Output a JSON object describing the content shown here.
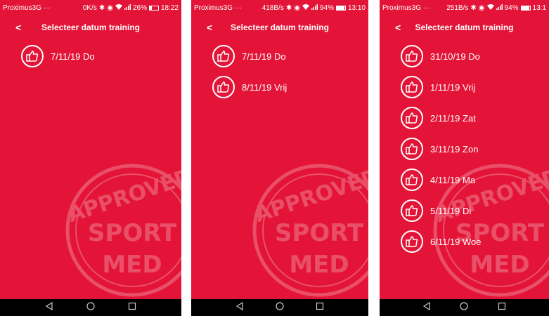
{
  "screens": [
    {
      "status": {
        "carrier": "Proximus3G ···",
        "speed": "0K/s",
        "battery": "26%",
        "time": "18:22",
        "battery_level": 0.26
      },
      "header": {
        "back": "<",
        "title": "Selecteer datum training"
      },
      "items": [
        "7/11/19 Do"
      ]
    },
    {
      "status": {
        "carrier": "Proximus3G ···",
        "speed": "418B/s",
        "battery": "94%",
        "time": "13:10",
        "battery_level": 0.94
      },
      "header": {
        "back": "<",
        "title": "Selecteer datum training"
      },
      "items": [
        "7/11/19 Do",
        "8/11/19 Vrij"
      ]
    },
    {
      "status": {
        "carrier": "Proximus3G ···",
        "speed": "251B/s",
        "battery": "94%",
        "time": "13:1",
        "battery_level": 0.94
      },
      "header": {
        "back": "<",
        "title": "Selecteer datum training"
      },
      "items": [
        "31/10/19 Do",
        "1/11/19 Vrij",
        "2/11/19 Zat",
        "3/11/19 Zon",
        "4/11/19 Ma",
        "5/11/19 Di",
        "6/11/19 Woe"
      ]
    }
  ],
  "colors": {
    "background": "#e31437",
    "text": "#ffffff",
    "navbar": "#000000"
  },
  "icons": {
    "item": "thumbs-up-icon",
    "nav": [
      "back-triangle-icon",
      "home-circle-icon",
      "recents-square-icon"
    ]
  },
  "stamp": {
    "top_text": "APPROVED",
    "middle_text": "SPORT",
    "bottom_text": "MED"
  }
}
